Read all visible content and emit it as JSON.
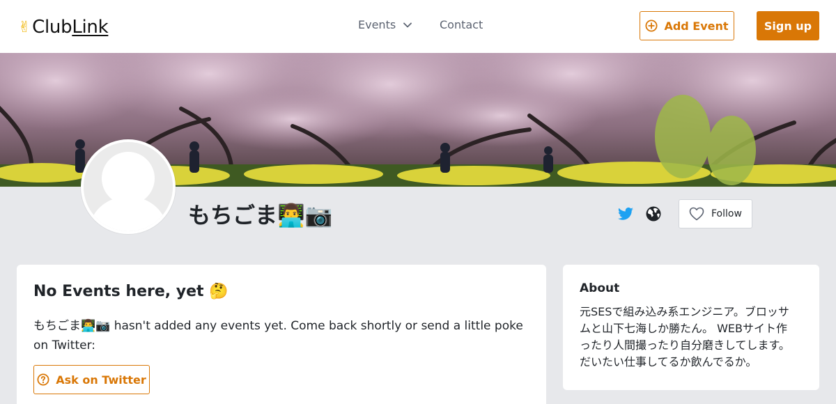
{
  "nav": {
    "logo_text": "ClubLink",
    "logo_prefix": "Club",
    "logo_suffix": "Link",
    "logo_icon": "victory-hand-icon",
    "events_label": "Events",
    "contact_label": "Contact",
    "add_event_label": "Add Event",
    "signup_label": "Sign up"
  },
  "profile": {
    "name": "もちごま👨‍💻📷",
    "follow_label": "Follow",
    "social_icons": [
      "twitter-icon",
      "globe-icon"
    ]
  },
  "events": {
    "title": "No Events here, yet 🤔",
    "message": "もちごま👨‍💻📷 hasn't added any events yet. Come back shortly or send a little poke on Twitter:",
    "ask_label": "Ask on Twitter"
  },
  "about": {
    "title": "About",
    "text": "元SESで組み込み系エンジニア。ブロッサムと山下七海しか勝たん。 WEBサイト作ったり人間撮ったり自分磨きしてします。 だいたい仕事してるか飲んでるか。"
  },
  "colors": {
    "accent": "#d97706",
    "twitter": "#1da1f2",
    "background": "#e7e8eb",
    "card": "#ffffff"
  }
}
